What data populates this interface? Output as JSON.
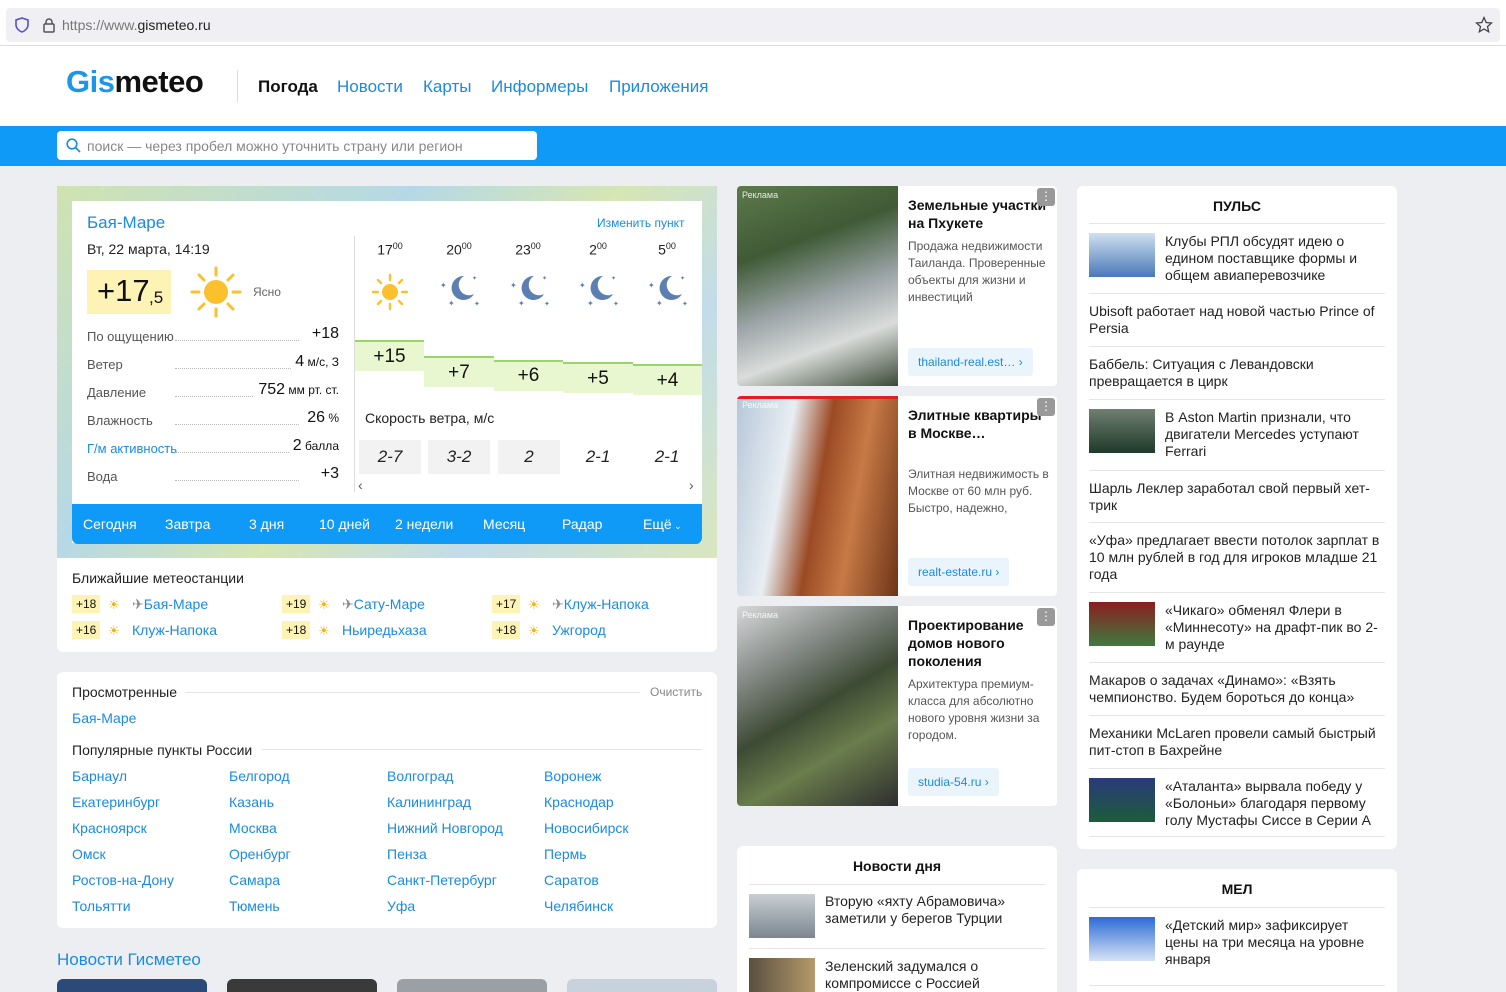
{
  "browser": {
    "url_prefix": "https://www.",
    "url_domain": "gismeteo.ru"
  },
  "header": {
    "logo_part1": "Gis",
    "logo_part2": "meteo",
    "nav": [
      "Погода",
      "Новости",
      "Карты",
      "Информеры",
      "Приложения"
    ]
  },
  "search": {
    "placeholder": "поиск — через пробел можно уточнить страну или регион"
  },
  "weather": {
    "city": "Бая-Маре",
    "change_label": "Изменить пункт",
    "datetime": "Вт, 22 марта, 14:19",
    "temp_main": "+17",
    "temp_frac": ",5",
    "condition": "Ясно",
    "params": [
      {
        "label": "По ощущению",
        "value": "+18",
        "unit": ""
      },
      {
        "label": "Ветер",
        "value": "4",
        "unit": " м/с, З"
      },
      {
        "label": "Давление",
        "value": "752",
        "unit": " мм рт. ст."
      },
      {
        "label": "Влажность",
        "value": "26",
        "unit": " %"
      },
      {
        "label": "Г/м активность",
        "value": "2",
        "unit": " балла"
      },
      {
        "label": "Вода",
        "value": "+3",
        "unit": ""
      }
    ],
    "hours": [
      "17",
      "20",
      "23",
      "2",
      "5"
    ],
    "hours_sup": "00",
    "hour_icons": [
      "sun-icon",
      "moon-stars-icon",
      "moon-stars-icon",
      "moon-stars-icon",
      "moon-stars-icon"
    ],
    "hour_temps": [
      "+15",
      "+7",
      "+6",
      "+5",
      "+4"
    ],
    "wind_label": "Скорость ветра, м/с",
    "wind_values": [
      "2-7",
      "3-2",
      "2",
      "2-1",
      "2-1"
    ],
    "tabs": [
      "Сегодня",
      "Завтра",
      "3 дня",
      "10 дней",
      "2 недели",
      "Месяц",
      "Радар",
      "Ещё"
    ]
  },
  "stations": {
    "title": "Ближайшие метеостанции",
    "items": [
      {
        "temp": "+18",
        "name": "Бая-Маре",
        "airport": true
      },
      {
        "temp": "+19",
        "name": "Сату-Маре",
        "airport": true
      },
      {
        "temp": "+17",
        "name": "Клуж-Напока",
        "airport": true
      },
      {
        "temp": "+16",
        "name": "Клуж-Напока",
        "airport": false
      },
      {
        "temp": "+18",
        "name": "Ньиредьхаза",
        "airport": false
      },
      {
        "temp": "+18",
        "name": "Ужгород",
        "airport": false
      }
    ]
  },
  "viewed": {
    "title": "Просмотренные",
    "clear": "Очистить",
    "items": [
      "Бая-Маре"
    ],
    "popular_title": "Популярные пункты России",
    "popular": [
      "Барнаул",
      "Белгород",
      "Волгоград",
      "Воронеж",
      "Екатеринбург",
      "Казань",
      "Калининград",
      "Краснодар",
      "Красноярск",
      "Москва",
      "Нижний Новгород",
      "Новосибирск",
      "Омск",
      "Оренбург",
      "Пенза",
      "Пермь",
      "Ростов-на-Дону",
      "Самара",
      "Санкт-Петербург",
      "Саратов",
      "Тольятти",
      "Тюмень",
      "Уфа",
      "Челябинск"
    ]
  },
  "gismeteo_news": {
    "title": "Новости Гисметео"
  },
  "ads": [
    {
      "label": "Реклама",
      "headline": "Земельные участки на Пхукете",
      "body": "Продажа недвижимости Таиланда. Проверенные объекты для жизни и инвестиций",
      "link": "thailand-real.est…",
      "more": "⋮"
    },
    {
      "label": "Реклама",
      "headline": "Элитные квартиры в Москве…",
      "body": "Элитная недвижимость в Москве от 60 млн руб. Быстро, надежно,",
      "link": "realt-estate.ru",
      "more": "⋮"
    },
    {
      "label": "Реклама",
      "headline": "Проектирование домов нового поколения",
      "body": "Архитектура премиум-класса для абсолютно нового уровня жизни за городом.",
      "link": "studia-54.ru",
      "more": "⋮"
    }
  ],
  "news_day": {
    "title": "Новости дня",
    "items": [
      "Вторую «яхту Абрамовича» заметили у берегов Турции",
      "Зеленский задумался о компромиссе с Россией"
    ]
  },
  "pulse": {
    "title": "ПУЛЬС",
    "items": [
      {
        "text": "Клубы РПЛ обсудят идею о едином поставщике формы и общем авиаперевозчике",
        "thumb": true
      },
      {
        "text": "Ubisoft работает над новой частью Prince of Persia",
        "thumb": false
      },
      {
        "text": "Баббель: Ситуация с Левандовски превращается в цирк",
        "thumb": false
      },
      {
        "text": "В Aston Martin признали, что двигатели Mercedes уступают Ferrari",
        "thumb": true
      },
      {
        "text": "Шарль Леклер заработал свой первый хет-трик",
        "thumb": false
      },
      {
        "text": "«Уфа» предлагает ввести потолок зарплат в 10 млн рублей в год для игроков младше 21 года",
        "thumb": false
      },
      {
        "text": "«Чикаго» обменял Флери в «Миннесоту» на драфт-пик во 2-м раунде",
        "thumb": true
      },
      {
        "text": "Макаров о задачах «Динамо»: «Взять чемпионство. Будем бороться до конца»",
        "thumb": false
      },
      {
        "text": "Механики McLaren провели самый быстрый пит-стоп в Бахрейне",
        "thumb": false
      },
      {
        "text": "«Аталанта» вырвала победу у «Болоньи» благодаря первому голу Мустафы Сиссе в Серии А",
        "thumb": true
      }
    ]
  },
  "mel": {
    "title": "МЕЛ",
    "items": [
      {
        "text": "«Детский мир» зафиксирует цены на три месяца на уровне января",
        "thumb": true
      }
    ]
  }
}
